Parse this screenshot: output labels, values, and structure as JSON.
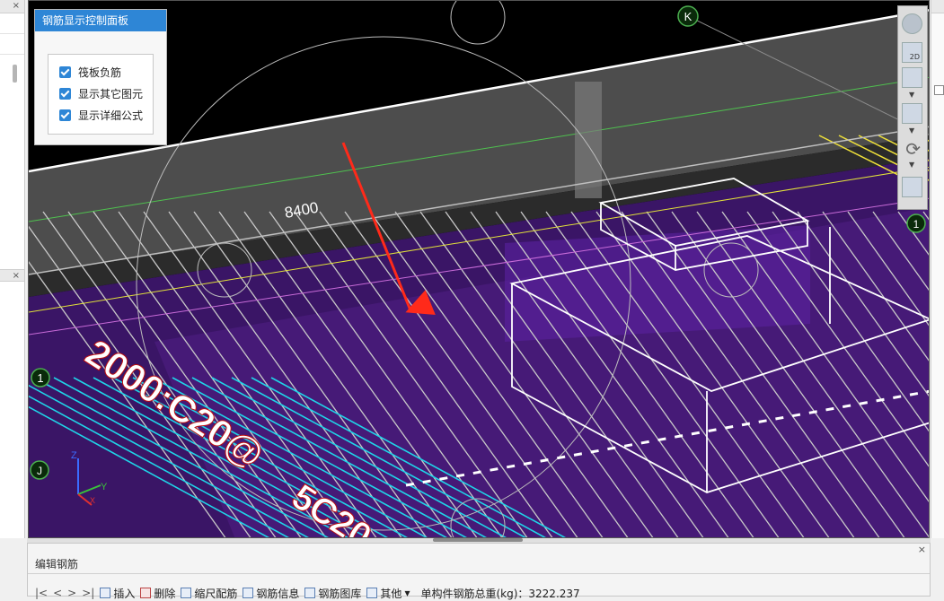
{
  "control_panel": {
    "title": "钢筋显示控制面板",
    "options": [
      {
        "label": "筏板负筋",
        "checked": true
      },
      {
        "label": "显示其它图元",
        "checked": true
      },
      {
        "label": "显示详细公式",
        "checked": true
      }
    ]
  },
  "viewport": {
    "dimension_label": "8400",
    "axis_markers": {
      "k": "K",
      "one_left": "1",
      "j": "J",
      "one_right": "1"
    },
    "rebar_labels": [
      "2000:C20@",
      "5C20"
    ],
    "axes": {
      "z": "Z",
      "y": "Y",
      "x": "X"
    }
  },
  "view_toolbar": {
    "btn_2d": "2D"
  },
  "panels": {
    "close_glyph": "×"
  },
  "editor": {
    "title": "编辑钢筋",
    "toolbar": {
      "nav": [
        "|<",
        "<",
        ">",
        ">|"
      ],
      "insert": "插入",
      "delete": "删除",
      "rebar_config": "缩尺配筋",
      "rebar_info": "钢筋信息",
      "rebar_library": "钢筋图库",
      "other": "其他",
      "total_weight_label": "单构件钢筋总重(kg)：",
      "total_weight_value": "3222.237"
    }
  },
  "colors": {
    "accent": "#2e86d6",
    "viewport_bg": "#000000",
    "slab_purple": "#3a1566",
    "rebar_cyan": "#1fd5e8",
    "rebar_yellow": "#f0e23a",
    "arrow_red": "#ff2a1a"
  }
}
